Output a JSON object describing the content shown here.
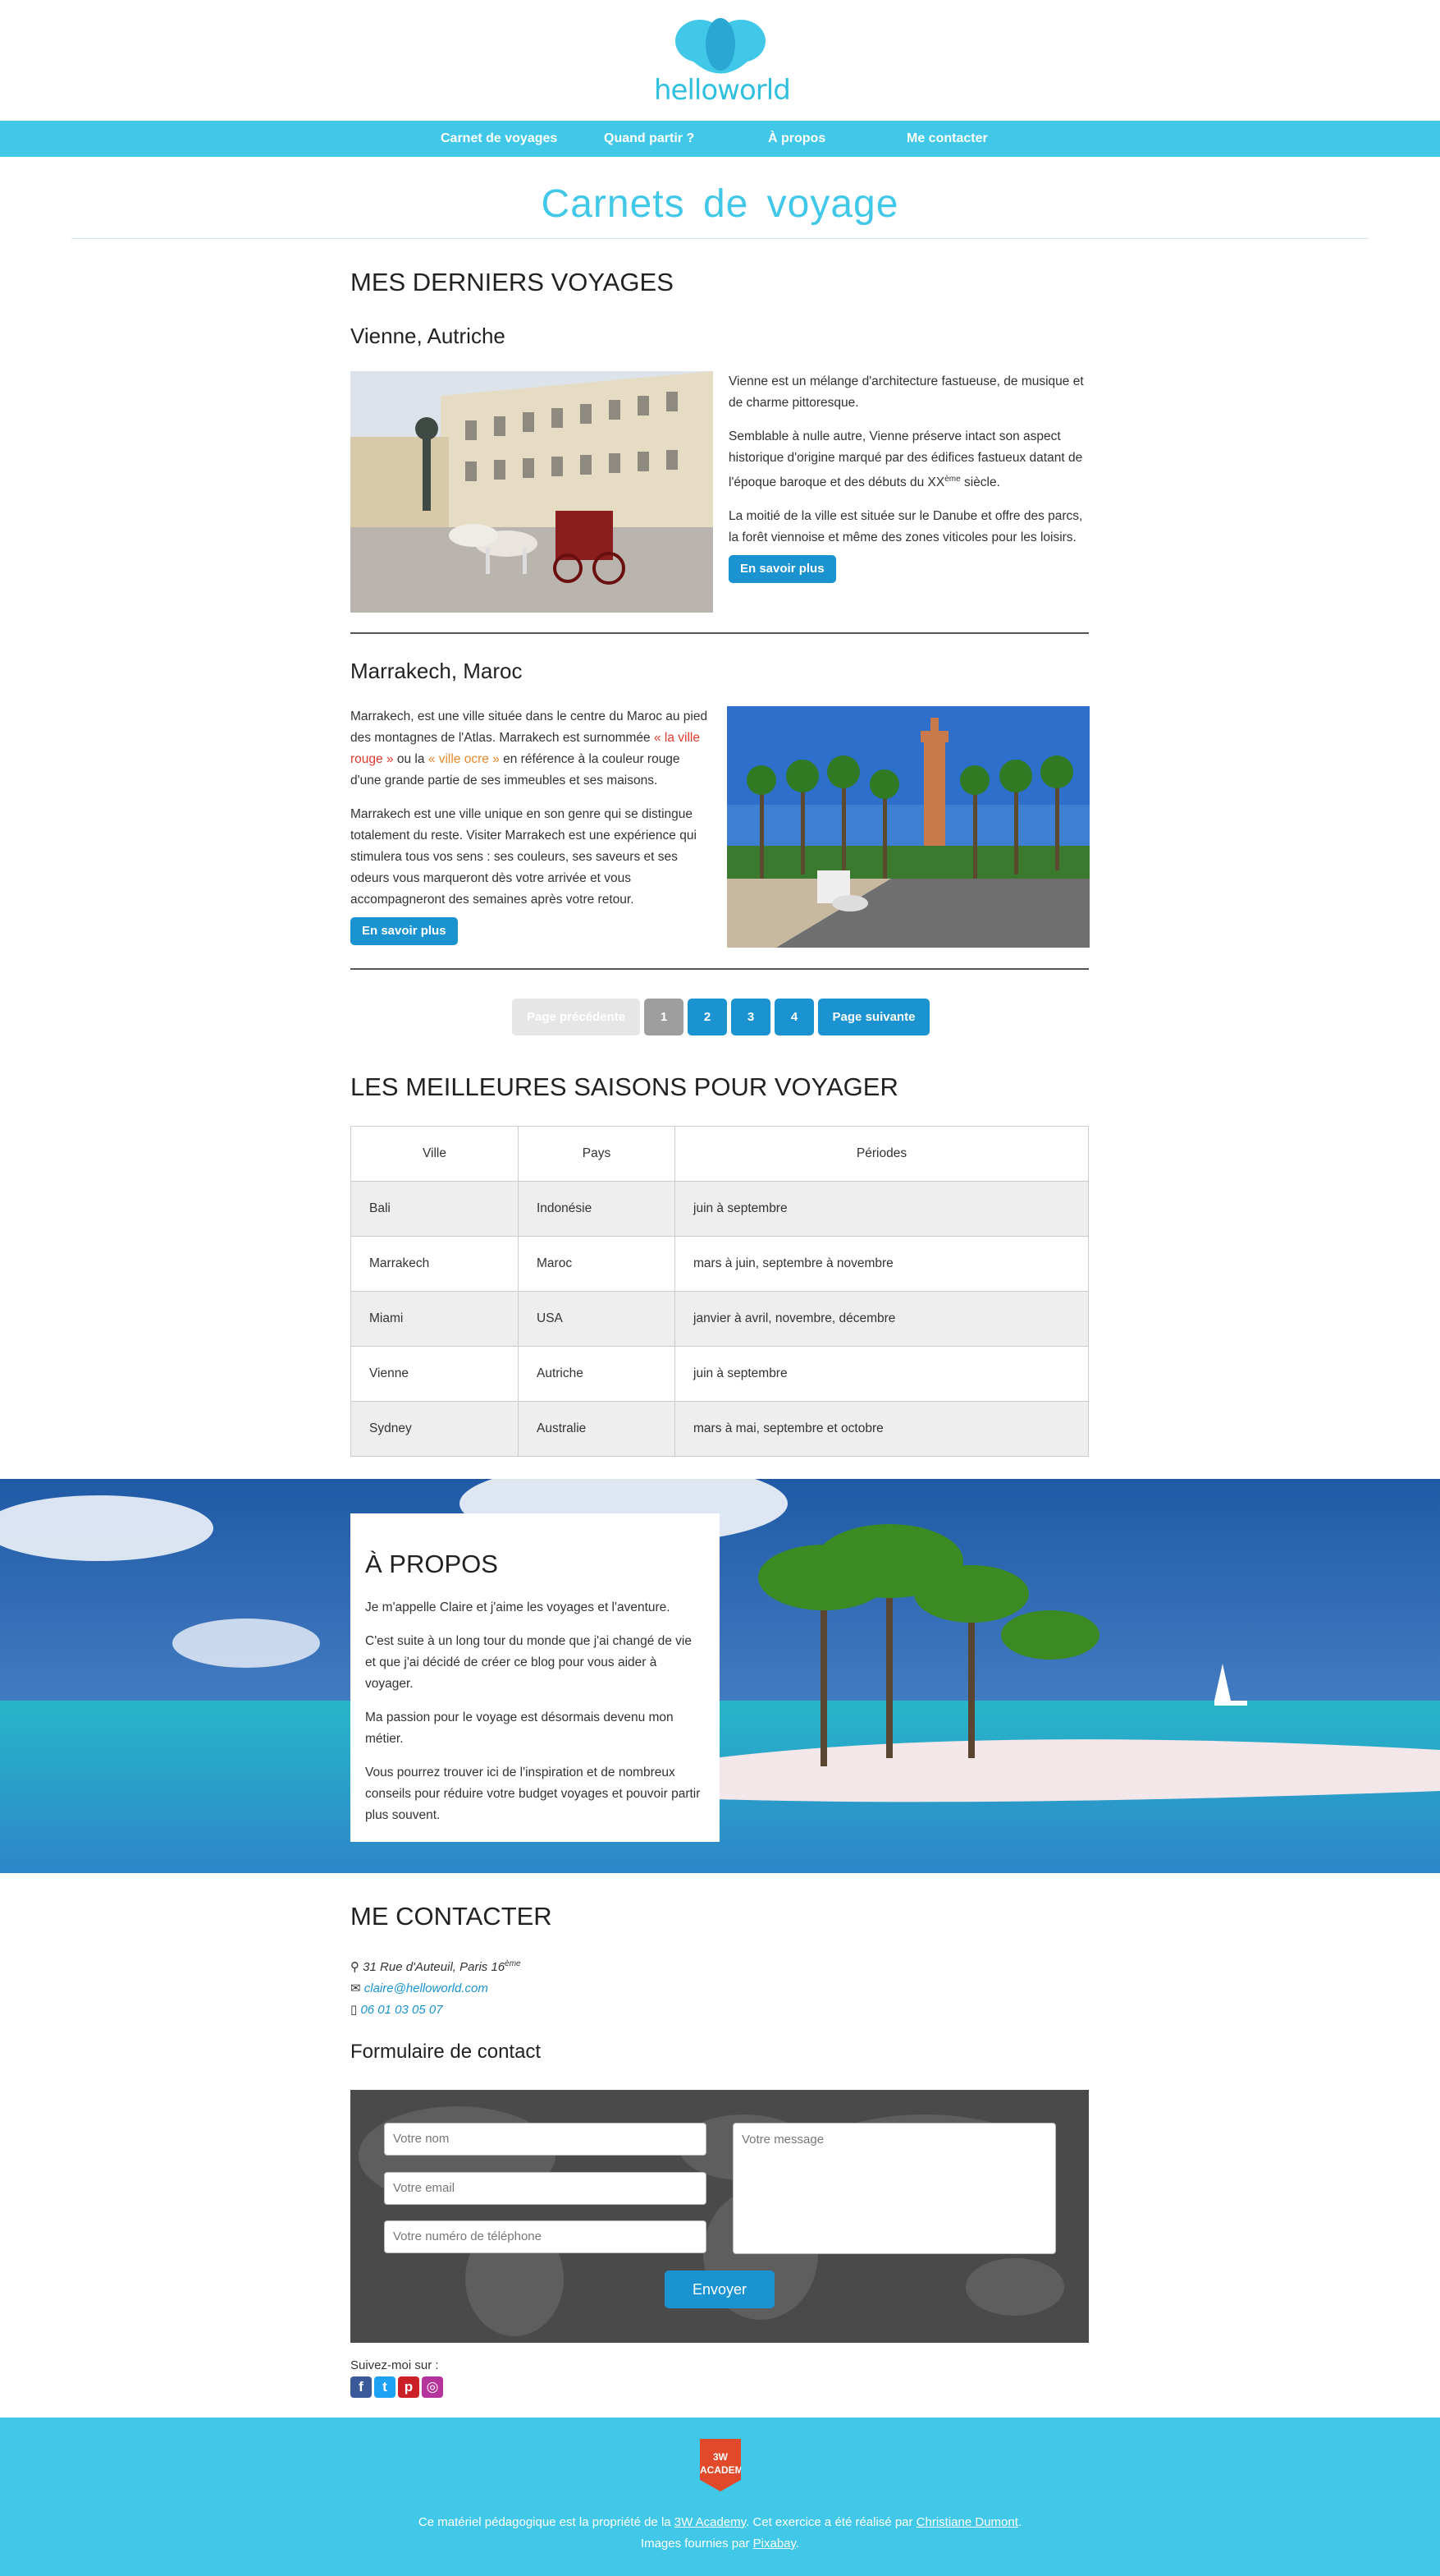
{
  "brand": {
    "name": "helloworld"
  },
  "nav": [
    "Carnet de voyages",
    "Quand partir ?",
    "À propos",
    "Me contacter"
  ],
  "page_title": "Carnets de voyage",
  "trips": {
    "heading": "MES DERNIERS VOYAGES",
    "vienne": {
      "title": "Vienne, Autriche",
      "p1": "Vienne est un mélange d'architecture fastueuse, de musique et de charme pittoresque.",
      "p2a": "Semblable à nulle autre, Vienne préserve intact son aspect historique d'origine marqué par des édifices fastueux datant de l'époque baroque et des débuts du XX",
      "p2sup": "ème",
      "p2b": " siècle.",
      "p3": "La moitié de la ville est située sur le Danube et offre des parcs, la forêt viennoise et même des zones viticoles pour les loisirs.",
      "button": "En savoir plus"
    },
    "marrakech": {
      "title": "Marrakech, Maroc",
      "p1a": "Marrakech, est une ville située dans le centre du Maroc au pied des montagnes de l'Atlas. Marrakech est surnommée ",
      "p1red": "« la ville rouge »",
      "p1b": " ou la ",
      "p1orange": "« ville ocre »",
      "p1c": " en référence à la couleur rouge d'une grande partie de ses immeubles et ses maisons.",
      "p2": "Marrakech est une ville unique en son genre qui se distingue totalement du reste. Visiter Marrakech est une expérience qui stimulera tous vos sens : ses couleurs, ses saveurs et ses odeurs vous marqueront dès votre arrivée et vous accompagneront des semaines après votre retour.",
      "button": "En savoir plus"
    }
  },
  "pagination": {
    "prev": "Page précédente",
    "pages": [
      "1",
      "2",
      "3",
      "4"
    ],
    "current": "1",
    "next": "Page suivante"
  },
  "seasons": {
    "heading": "LES MEILLEURES SAISONS POUR VOYAGER",
    "columns": [
      "Ville",
      "Pays",
      "Périodes"
    ],
    "rows": [
      [
        "Bali",
        "Indonésie",
        "juin à septembre"
      ],
      [
        "Marrakech",
        "Maroc",
        "mars à juin, septembre à novembre"
      ],
      [
        "Miami",
        "USA",
        "janvier à avril, novembre, décembre"
      ],
      [
        "Vienne",
        "Autriche",
        "juin à septembre"
      ],
      [
        "Sydney",
        "Australie",
        "mars à mai, septembre et octobre"
      ]
    ]
  },
  "about": {
    "heading": "À PROPOS",
    "p1": "Je m'appelle Claire et j'aime les voyages et l'aventure.",
    "p2": "C'est suite à un long tour du monde que j'ai changé de vie et que j'ai décidé de créer ce blog pour vous aider à voyager.",
    "p3": "Ma passion pour le voyage est désormais devenu mon métier.",
    "p4": "Vous pourrez trouver ici de l'inspiration et de nombreux conseils pour réduire votre budget voyages et pouvoir partir plus souvent."
  },
  "contact": {
    "heading": "ME CONTACTER",
    "address": "31 Rue d'Auteuil, Paris 16",
    "address_sup": "ème",
    "email": "claire@helloworld.com",
    "phone": "06 01 03 05 07",
    "form_title": "Formulaire de contact",
    "ph_name": "Votre nom",
    "ph_email": "Votre email",
    "ph_phone": "Votre numéro de téléphone",
    "ph_message": "Votre message",
    "submit": "Envoyer",
    "follow": "Suivez-moi sur :",
    "socials": [
      "facebook-icon",
      "twitter-icon",
      "pinterest-icon",
      "instagram-icon"
    ]
  },
  "footer": {
    "badge": "3W ACADEMY",
    "l1a": "Ce matériel pédagogique est la propriété de la ",
    "l1link1": "3W Academy",
    "l1b": ". Cet exercice a été réalisé par ",
    "l1link2": "Christiane Dumont",
    "l1c": ".",
    "l2a": "Images fournies par ",
    "l2link": "Pixabay",
    "l2b": "."
  },
  "colors": {
    "accent": "#41c8e8",
    "button": "#1a93d0",
    "red": "#e03b2c",
    "orange": "#e9892c"
  }
}
